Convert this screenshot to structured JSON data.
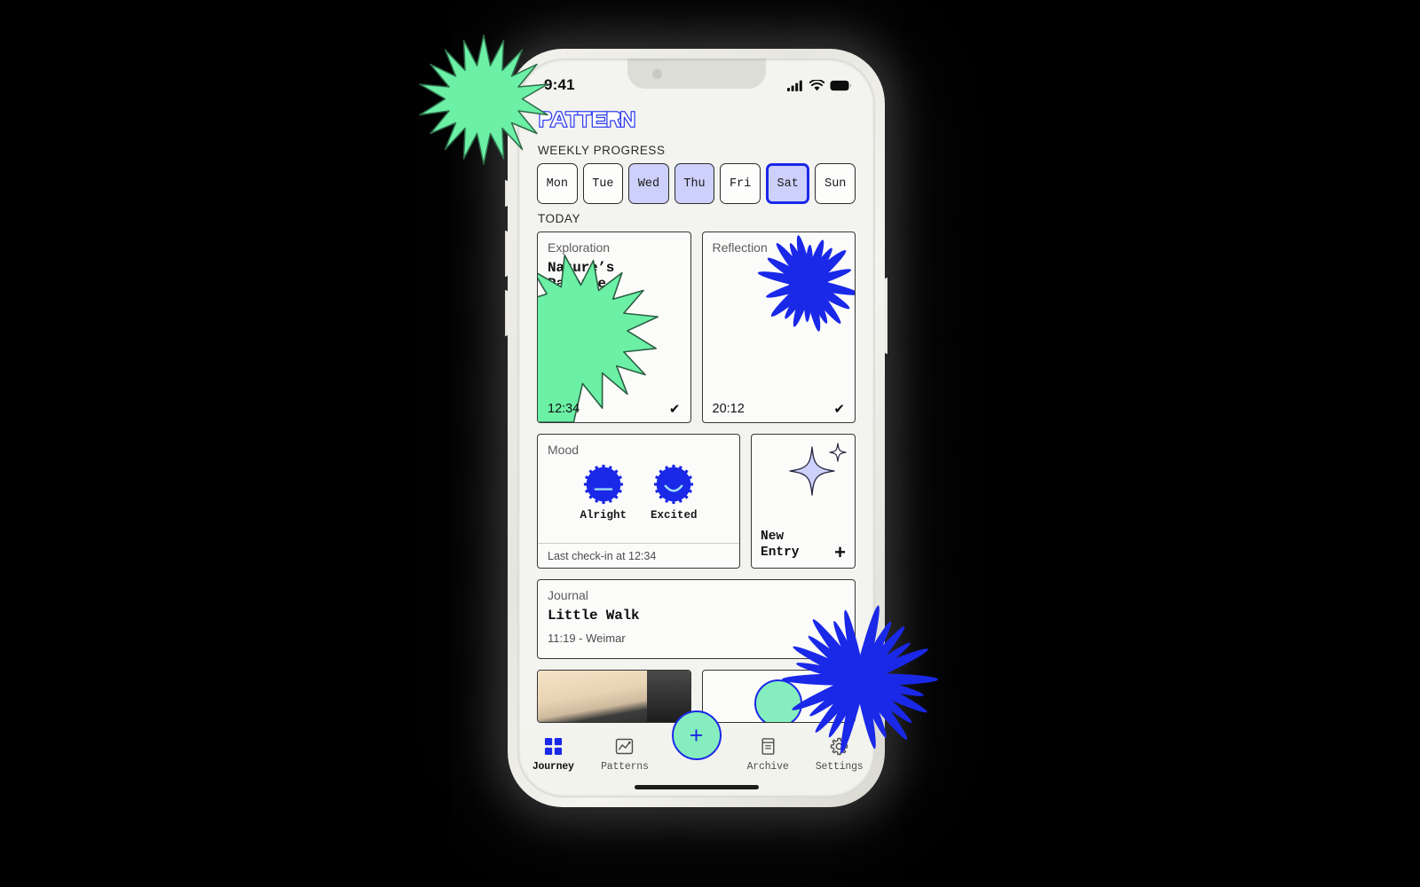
{
  "device": {
    "status_bar": {
      "time": "9:41",
      "cellular_icon": "signal-bars-icon",
      "wifi_icon": "wifi-icon",
      "battery_icon": "battery-icon"
    },
    "home_indicator": "home-indicator"
  },
  "app": {
    "logo_text": "PATTERN",
    "brand_blue": "#1a28e8",
    "brand_green": "#86edbe",
    "brand_lavender": "#ccd0fa",
    "screen_bg": "#f3f3ef"
  },
  "weekly_progress": {
    "label": "WEEKLY PROGRESS",
    "days": [
      {
        "label": "Mon",
        "state": "empty"
      },
      {
        "label": "Tue",
        "state": "empty"
      },
      {
        "label": "Wed",
        "state": "filled"
      },
      {
        "label": "Thu",
        "state": "filled"
      },
      {
        "label": "Fri",
        "state": "empty"
      },
      {
        "label": "Sat",
        "state": "selected"
      },
      {
        "label": "Sun",
        "state": "empty"
      }
    ]
  },
  "today": {
    "label": "TODAY",
    "cards": [
      {
        "kicker": "Exploration",
        "title": "Nature’s Palette",
        "time": "12:34",
        "check": "✔",
        "art": "green-spiky-burst"
      },
      {
        "kicker": "Reflection",
        "title": "",
        "time": "20:12",
        "check": "✔",
        "art": "blue-star-burst"
      }
    ]
  },
  "mood": {
    "kicker": "Mood",
    "options": [
      {
        "label": "Alright",
        "face": "neutral-face-icon"
      },
      {
        "label": "Excited",
        "face": "smile-face-icon"
      }
    ],
    "footer": "Last check-in at 12:34"
  },
  "new_entry": {
    "line1": "New",
    "line2": "Entry",
    "plus": "+",
    "sparkle_icon": "sparkle-icon"
  },
  "journal": {
    "kicker": "Journal",
    "title": "Little Walk",
    "meta": "11:19 - Weimar"
  },
  "peek_cards": [
    {
      "type": "photo-thumbnail"
    },
    {
      "type": "green-circle-thumbnail"
    }
  ],
  "nav": {
    "items": [
      {
        "label": "Journey",
        "icon": "grid-squares-icon",
        "active": true
      },
      {
        "label": "Patterns",
        "icon": "chart-box-icon",
        "active": false
      },
      {
        "label": "Archive",
        "icon": "book-icon",
        "active": false
      },
      {
        "label": "Settings",
        "icon": "gear-icon",
        "active": false
      }
    ],
    "fab": {
      "label": "+",
      "icon": "plus-icon"
    }
  },
  "decorations": [
    {
      "name": "green-starburst",
      "color": "#6bf0a6"
    },
    {
      "name": "blue-starburst",
      "color": "#1a28e8"
    }
  ]
}
